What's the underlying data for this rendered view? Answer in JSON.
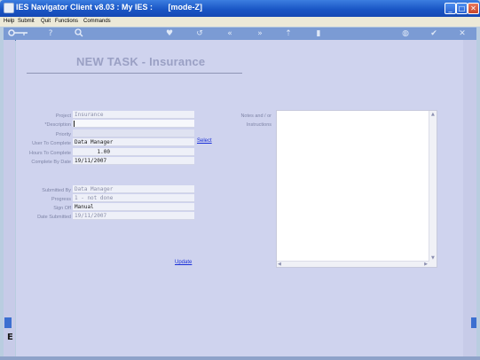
{
  "window": {
    "title": "IES Navigator Client v8.03 : My IES :       [mode-Z]"
  },
  "menu": {
    "items": [
      "Help",
      "Submit",
      "Quit",
      "Functions",
      "Commands"
    ]
  },
  "toolbar": {
    "icons": [
      "key-icon",
      "help-icon",
      "search-icon",
      "heart-icon",
      "rewind-icon",
      "back-icon",
      "forward-icon",
      "exit-icon",
      "stop-icon",
      "globe-icon",
      "check-icon",
      "close-icon"
    ]
  },
  "form": {
    "title": "NEW TASK - Insurance",
    "project": {
      "label": "Project",
      "value": "Insurance"
    },
    "description": {
      "label": "*Description",
      "value": ""
    },
    "priority": {
      "label": "Priority",
      "value": ""
    },
    "user_to_complete": {
      "label": "User To Complete",
      "value": "Data Manager"
    },
    "select_link": "Select",
    "hours_to_complete": {
      "label": "Hours To Complete",
      "value": "1.00"
    },
    "complete_by_date": {
      "label": "Complete By Date",
      "value": "19/11/2007"
    },
    "submitted_by": {
      "label": "Submitted By",
      "value": "Data Manager"
    },
    "progress": {
      "label": "Progress",
      "value": "1 - not done"
    },
    "sign_off": {
      "label": "Sign Off",
      "value": "Manual"
    },
    "date_submitted": {
      "label": "Date Submitted",
      "value": "19/11/2007"
    },
    "notes_label_1": "Notes and / or",
    "notes_label_2": "Instructions",
    "notes_value": "",
    "update_link": "Update"
  }
}
